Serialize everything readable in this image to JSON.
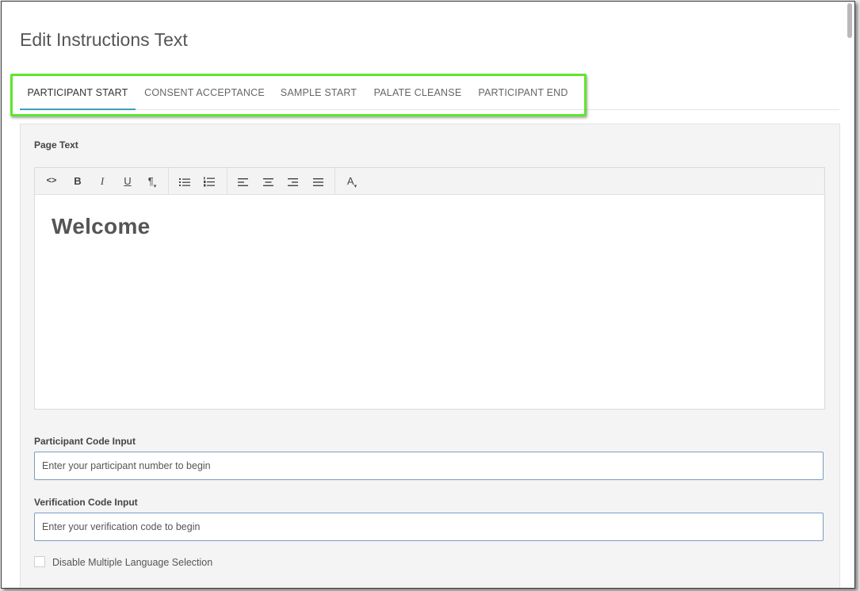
{
  "page": {
    "title": "Edit Instructions Text"
  },
  "tabs": [
    {
      "label": "PARTICIPANT START",
      "active": true
    },
    {
      "label": "CONSENT ACCEPTANCE",
      "active": false
    },
    {
      "label": "SAMPLE START",
      "active": false
    },
    {
      "label": "PALATE CLEANSE",
      "active": false
    },
    {
      "label": "PARTICIPANT END",
      "active": false
    }
  ],
  "editor": {
    "label": "Page Text",
    "content": "Welcome",
    "toolbar": [
      {
        "icon": "code-view-icon",
        "glyph": "<>"
      },
      {
        "icon": "bold-icon",
        "glyph": "B"
      },
      {
        "icon": "italic-icon",
        "glyph": "I"
      },
      {
        "icon": "underline-icon",
        "glyph": "U"
      },
      {
        "icon": "paragraph-icon",
        "glyph": "¶"
      },
      {
        "icon": "bullet-list-icon",
        "glyph": ""
      },
      {
        "icon": "numbered-list-icon",
        "glyph": ""
      },
      {
        "icon": "align-left-icon",
        "glyph": ""
      },
      {
        "icon": "align-center-icon",
        "glyph": ""
      },
      {
        "icon": "align-right-icon",
        "glyph": ""
      },
      {
        "icon": "align-justify-icon",
        "glyph": ""
      },
      {
        "icon": "font-color-icon",
        "glyph": "A"
      }
    ]
  },
  "participant_code": {
    "label": "Participant Code Input",
    "placeholder": "Enter your participant number to begin"
  },
  "verification_code": {
    "label": "Verification Code Input",
    "placeholder": "Enter your verification code to begin"
  },
  "language_option": {
    "label": "Disable Multiple Language Selection",
    "checked": false
  },
  "colors": {
    "highlight": "#5ee62a",
    "active_tab_underline": "#3aa0b8",
    "input_border": "#7c9cc4"
  }
}
